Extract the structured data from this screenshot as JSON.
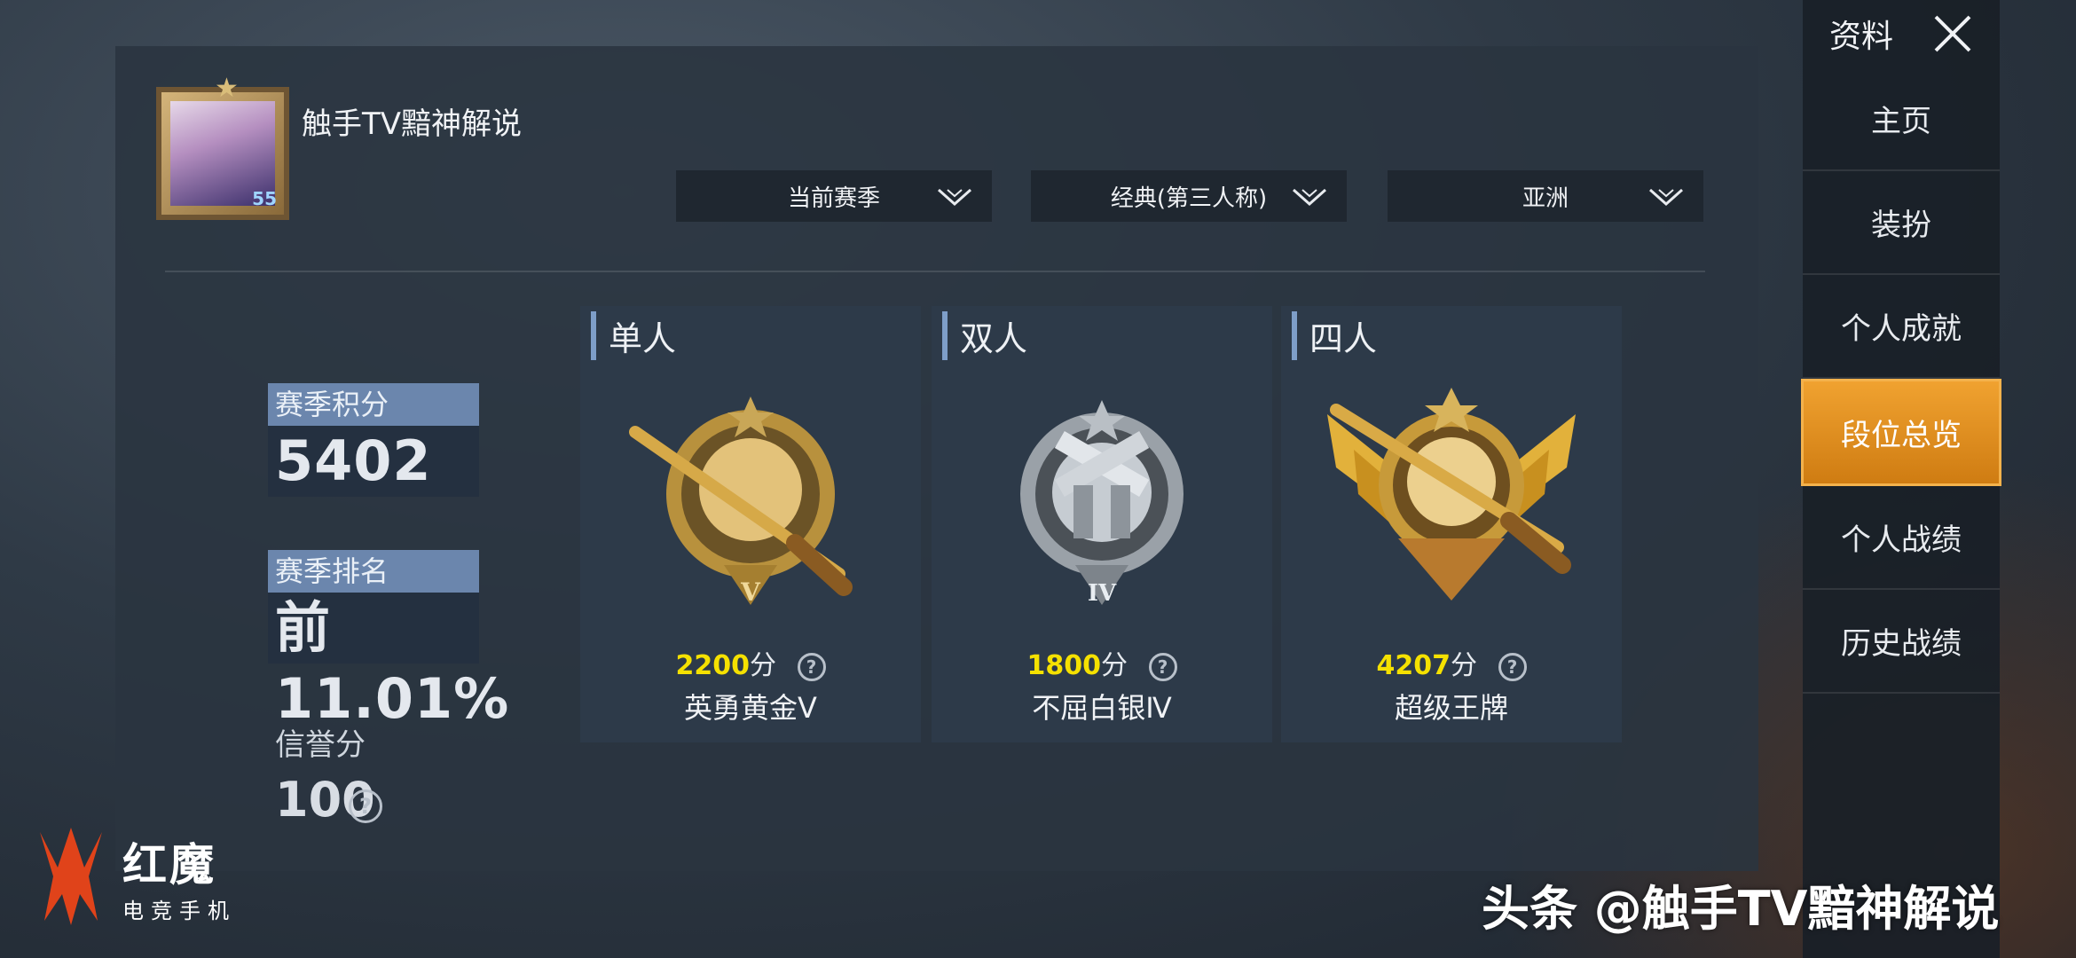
{
  "profile": {
    "name": "触手TV黯神解说",
    "level": "55"
  },
  "filters": [
    {
      "label": "当前赛季"
    },
    {
      "label": "经典(第三人称)"
    },
    {
      "label": "亚洲"
    }
  ],
  "stats": {
    "season_points_label": "赛季积分",
    "season_points": "5402",
    "season_rank_label": "赛季排名",
    "season_rank": "前11.01%",
    "credit_label": "信誉分",
    "credit_value": "100",
    "help_symbol": "?"
  },
  "modes": [
    {
      "title": "单人",
      "score": "2200",
      "unit": "分",
      "tier": "英勇黄金Ⅴ",
      "badge": "gold-rifle-badge-icon",
      "accent": "#f5e100"
    },
    {
      "title": "双人",
      "score": "1800",
      "unit": "分",
      "tier": "不屈白银Ⅳ",
      "badge": "silver-pistols-badge-icon",
      "accent": "#f5e100"
    },
    {
      "title": "四人",
      "score": "4207",
      "unit": "分",
      "tier": "超级王牌",
      "badge": "ace-winged-badge-icon",
      "accent": "#f5e100"
    }
  ],
  "sidebar": {
    "title": "资料",
    "items": [
      {
        "label": "主页"
      },
      {
        "label": "装扮"
      },
      {
        "label": "个人成就"
      },
      {
        "label": "段位总览",
        "active": true
      },
      {
        "label": "个人战绩"
      },
      {
        "label": "历史战绩"
      }
    ]
  },
  "brand": {
    "name": "红魔",
    "sub": "电竞手机"
  },
  "watermark": "头条 @触手TV黯神解说",
  "colors": {
    "active_nav": "#e08c1c",
    "score_highlight": "#f5e100",
    "label_bg": "#6b86ad"
  }
}
